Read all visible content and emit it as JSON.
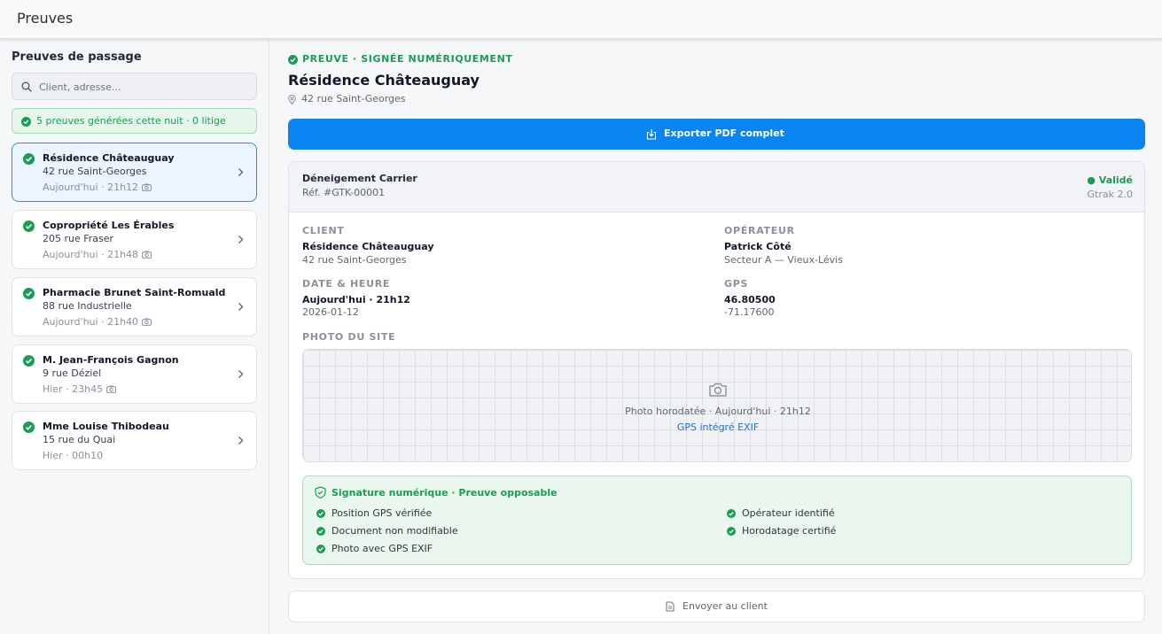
{
  "header": {
    "title": "Preuves"
  },
  "sidebar": {
    "heading": "Preuves de passage",
    "search_placeholder": "Client, adresse...",
    "banner": "5 preuves générées cette nuit · 0 litige",
    "cards": [
      {
        "name": "Résidence Châteauguay",
        "address": "42 rue Saint-Georges",
        "time": "Aujourd'hui · 21h12",
        "photo": true,
        "active": true
      },
      {
        "name": "Copropriété Les Érables",
        "address": "205 rue Fraser",
        "time": "Aujourd'hui · 21h48",
        "photo": true,
        "active": false
      },
      {
        "name": "Pharmacie Brunet Saint-Romuald",
        "address": "88 rue Industrielle",
        "time": "Aujourd'hui · 21h40",
        "photo": true,
        "active": false
      },
      {
        "name": "M. Jean-François Gagnon",
        "address": "9 rue Déziel",
        "time": "Hier · 23h45",
        "photo": true,
        "active": false
      },
      {
        "name": "Mme Louise Thibodeau",
        "address": "15 rue du Quai",
        "time": "Hier · 00h10",
        "photo": false,
        "active": false
      }
    ]
  },
  "detail": {
    "status": "PREUVE · SIGNÉE NUMÉRIQUEMENT",
    "title": "Résidence Châteauguay",
    "address": "42 rue Saint-Georges",
    "export_label": "Exporter PDF complet",
    "doc": {
      "company": "Déneigement Carrier",
      "ref": "Réf. #GTK-00001",
      "validity": "● Validé",
      "version": "Gtrak 2.0",
      "client_label": "CLIENT",
      "client_name": "Résidence Châteauguay",
      "client_address": "42 rue Saint-Georges",
      "operator_label": "OPÉRATEUR",
      "operator_name": "Patrick Côté",
      "operator_sector": "Secteur A — Vieux-Lévis",
      "date_label": "DATE & HEURE",
      "date_main": "Aujourd'hui · 21h12",
      "date_sub": "2026-01-12",
      "gps_label": "GPS",
      "gps_lat": "46.80500",
      "gps_lon": "-71.17600",
      "photo_label": "PHOTO DU SITE",
      "photo_caption": "Photo horodatée · Aujourd'hui · 21h12",
      "photo_gps": "GPS intégré EXIF",
      "signature": {
        "title": "Signature numérique · Preuve opposable",
        "items": [
          "Position GPS vérifiée",
          "Opérateur identifié",
          "Document non modifiable",
          "Horodatage certifié",
          "Photo avec GPS EXIF"
        ]
      }
    },
    "send_label": "Envoyer au client"
  },
  "colors": {
    "accent": "#0a84f0",
    "success": "#1a9c55",
    "active_border": "#17a2b8"
  }
}
